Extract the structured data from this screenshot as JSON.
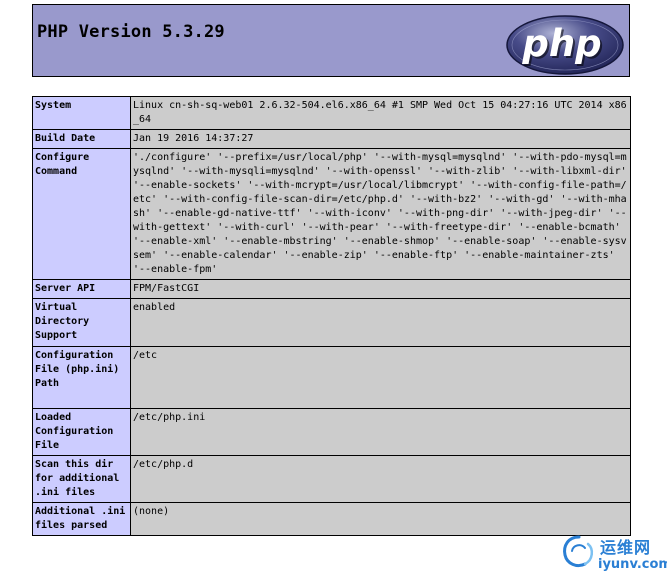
{
  "header": {
    "title": "PHP Version 5.3.29",
    "logo_text": "php",
    "background": "#9999cc"
  },
  "colors": {
    "key_background": "#ccccff",
    "value_background": "#cccccc",
    "border": "#000000",
    "watermark": "#2a7fd4"
  },
  "rows": [
    {
      "key": "System",
      "value": "Linux cn-sh-sq-web01 2.6.32-504.el6.x86_64 #1 SMP Wed Oct 15 04:27:16 UTC 2014 x86_64"
    },
    {
      "key": "Build Date",
      "value": "Jan 19 2016 14:37:27"
    },
    {
      "key": "Configure Command",
      "value": "'./configure' '--prefix=/usr/local/php' '--with-mysql=mysqlnd' '--with-pdo-mysql=mysqlnd' '--with-mysqli=mysqlnd' '--with-openssl' '--with-zlib' '--with-libxml-dir' '--enable-sockets' '--with-mcrypt=/usr/local/libmcrypt' '--with-config-file-path=/etc' '--with-config-file-scan-dir=/etc/php.d' '--with-bz2' '--with-gd' '--with-mhash' '--enable-gd-native-ttf' '--with-iconv' '--with-png-dir' '--with-jpeg-dir' '--with-gettext' '--with-curl' '--with-pear' '--with-freetype-dir' '--enable-bcmath' '--enable-xml' '--enable-mbstring' '--enable-shmop' '--enable-soap' '--enable-sysvsem' '--enable-calendar' '--enable-zip' '--enable-ftp' '--enable-maintainer-zts' '--enable-fpm'"
    },
    {
      "key": "Server API",
      "value": "FPM/FastCGI"
    },
    {
      "key": "Virtual Directory Support",
      "value": "enabled"
    },
    {
      "key": "Configuration File (php.ini) Path",
      "value": "/etc"
    },
    {
      "key": "Loaded Configuration File",
      "value": "/etc/php.ini"
    },
    {
      "key": "Scan this dir for additional .ini files",
      "value": "/etc/php.d"
    },
    {
      "key": "Additional .ini files parsed",
      "value": "(none)"
    }
  ],
  "watermark": {
    "name_cn": "运维网",
    "url": "iyunv.com",
    "icon": "swirl-logo-icon"
  }
}
